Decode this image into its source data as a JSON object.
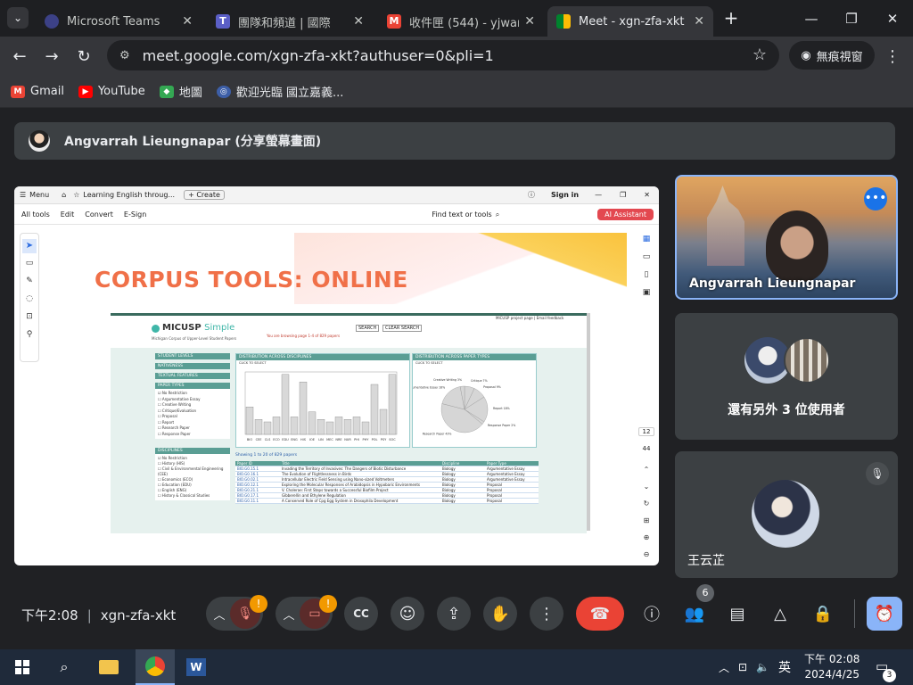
{
  "tabs": [
    {
      "title": "Microsoft Teams",
      "icon": "teams-icon"
    },
    {
      "title": "團隊和頻道 | 國際",
      "icon": "teams-icon"
    },
    {
      "title": "收件匣 (544) - yjwang",
      "icon": "gmail-icon"
    },
    {
      "title": "Meet - xgn-zfa-xkt",
      "icon": "meet-icon",
      "active": true
    }
  ],
  "browser": {
    "url": "meet.google.com/xgn-zfa-xkt?authuser=0&pli=1",
    "incognito_label": "無痕視窗"
  },
  "bookmarks": [
    {
      "label": "Gmail"
    },
    {
      "label": "YouTube"
    },
    {
      "label": "地圖"
    },
    {
      "label": "歡迎光臨 國立嘉義..."
    }
  ],
  "meet": {
    "presenter_banner": "Angvarrah Lieungnapar (分享螢幕畫面)",
    "main_tile_name": "Angvarrah Lieungnapar",
    "others_text": "還有另外 3 位使用者",
    "third_tile_name": "王云芷",
    "time": "下午2:08",
    "meeting_code": "xgn-zfa-xkt",
    "participants_count": "6",
    "alert_badge": "!"
  },
  "shared": {
    "tab_menu": "Menu",
    "tab_title": "Learning English throug...",
    "tab_create": "+ Create",
    "sign_in": "Sign in",
    "tools": [
      "All tools",
      "Edit",
      "Convert",
      "E-Sign"
    ],
    "find": "Find text or tools",
    "ai": "AI Assistant",
    "slide_title": "CORPUS TOOLS: ONLINE",
    "page_num": "12",
    "page_total": "44",
    "micusp": {
      "logo": "MICUSP",
      "logo2": "Simple",
      "sub": "Michigan Corpus of Upper-Level Student Papers",
      "search_btn": "SEARCH",
      "clear_btn": "CLEAR SEARCH",
      "status": "You are browsing page 1-4 of 829 papers",
      "top_links": "MICUSP project page  |  Email feedback",
      "sidebar": [
        "STUDENT LEVELS",
        "NATIVENESS",
        "TEXTUAL FEATURES",
        "PAPER TYPES"
      ],
      "paper_types": [
        "No Restriction",
        "Argumentative Essay",
        "Creative Writing",
        "Critique/Evaluation",
        "Proposal",
        "Report",
        "Research Paper",
        "Response Paper"
      ],
      "disciplines_head": "DISCIPLINES",
      "disciplines": [
        "No Restriction",
        "History (HIS)",
        "Civil & Environmental Engineering (CEE)",
        "Economics (ECO)",
        "Education (EDU)",
        "English (ENG)",
        "History & Classical Studies"
      ],
      "dist_disc": "DISTRIBUTION ACROSS DISCIPLINES",
      "dist_types": "DISTRIBUTION ACROSS PAPER TYPES",
      "click_select": "CLICK TO SELECT",
      "showing": "Showing 1 to 20 of 829 papers",
      "headers": [
        "Paper ID",
        "Title",
        "Discipline",
        "Paper Type"
      ],
      "rows": [
        [
          "BIO.G0.15.1",
          "Invading the Territory of Invasives: The Dangers of Biotic Disturbance",
          "Biology",
          "Argumentative Essay"
        ],
        [
          "BIO.G0.16.1",
          "The Evolution of Flightlessness in Birds",
          "Biology",
          "Argumentative Essay"
        ],
        [
          "BIO.G0.02.1",
          "Intracellular Electric Field Sensing using Nano-sized Voltmeters",
          "Biology",
          "Argumentative Essay"
        ],
        [
          "BIO.G0.12.1",
          "Exploring the Molecular Responses of Arabidopsis in Hypobaric Environments",
          "Biology",
          "Proposal"
        ],
        [
          "BIO.G0.21.1",
          "V. Cholerae: First Steps towards a Successful Biofilm Project",
          "Biology",
          "Proposal"
        ],
        [
          "BIO.G0.17.1",
          "Gibberellin and Ethylene Regulation",
          "Biology",
          "Proposal"
        ],
        [
          "BIO.G0.11.1",
          "A Conserved Role of Cpg Egg System in Drosophila Development",
          "Biology",
          "Proposal"
        ]
      ]
    }
  },
  "chart_data": {
    "type": "bar",
    "categories": [
      "BIO",
      "CEE",
      "CLS",
      "ECO",
      "EDU",
      "ENG",
      "HIS",
      "IOE",
      "LIN",
      "MEC",
      "NRE",
      "NUR",
      "PHI",
      "PHY",
      "POL",
      "PSY",
      "SOC"
    ],
    "values": [
      22,
      12,
      10,
      14,
      48,
      14,
      42,
      18,
      12,
      10,
      14,
      12,
      14,
      10,
      40,
      20,
      48
    ],
    "ylim": [
      0,
      50
    ],
    "pie": {
      "labels": [
        "Critique 7%",
        "Proposal 9%",
        "Report 18%",
        "Response Paper 2%",
        "Research Paper 43%",
        "Argumentative Essay 18%",
        "Creative Writing 3%"
      ],
      "values": [
        7,
        9,
        18,
        2,
        43,
        18,
        3
      ]
    }
  },
  "taskbar": {
    "time": "下午 02:08",
    "date": "2024/4/25",
    "ime": "英",
    "notifications": "3"
  },
  "colors": {
    "accent": "#8ab4f8",
    "hangup": "#ea4335",
    "alert": "#f29900",
    "slide_title": "#f07048"
  }
}
